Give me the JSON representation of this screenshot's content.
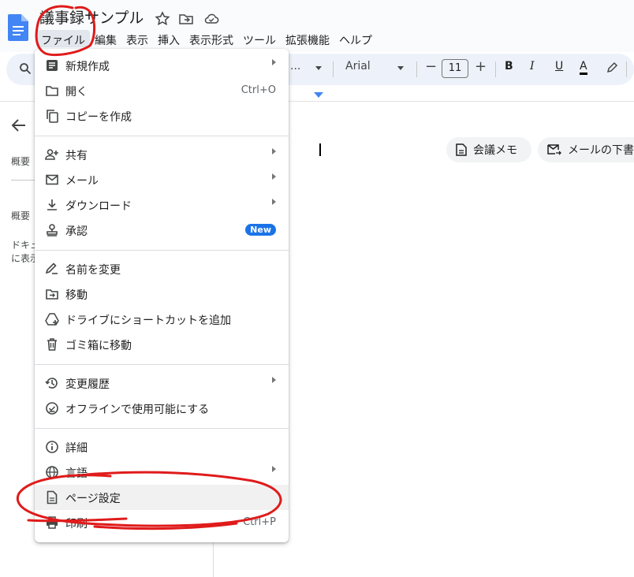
{
  "app": {
    "doc_title": "議事録サンプル",
    "menubar": [
      "ファイル",
      "編集",
      "表示",
      "挿入",
      "表示形式",
      "ツール",
      "拡張機能",
      "ヘルプ"
    ],
    "active_menu": "ファイル"
  },
  "toolbar": {
    "style_trunc": "...",
    "font_name": "Arial",
    "font_size": "11",
    "minus": "−",
    "plus": "+",
    "bold": "B",
    "italic": "I",
    "underline": "U",
    "text_color": "A"
  },
  "sidebar": {
    "label1": "概要",
    "label2": "概要",
    "text_line1": "ドキュ",
    "text_line2": "に表示"
  },
  "chips": {
    "meeting_notes": "会議メモ",
    "email_draft": "メールの下書"
  },
  "file_menu": {
    "new": "新規作成",
    "open": "開く",
    "open_shortcut": "Ctrl+O",
    "copy": "コピーを作成",
    "share": "共有",
    "email": "メール",
    "download": "ダウンロード",
    "approval": "承認",
    "approval_badge": "New",
    "rename": "名前を変更",
    "move": "移動",
    "add_shortcut": "ドライブにショートカットを追加",
    "trash": "ゴミ箱に移動",
    "version_history": "変更履歴",
    "offline": "オフラインで使用可能にする",
    "details": "詳細",
    "language": "言語",
    "page_setup": "ページ設定",
    "print": "印刷",
    "print_shortcut": "Ctrl+P"
  },
  "colors": {
    "accent": "#1a73e8",
    "annotation": "#e01b1b"
  }
}
